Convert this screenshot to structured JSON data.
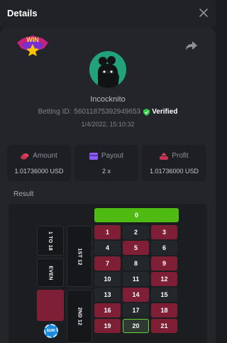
{
  "header": {
    "title": "Details",
    "close_icon": "close-icon"
  },
  "win_badge": {
    "text": "WIN"
  },
  "player": {
    "username": "Incocknito",
    "betting_id_label": "Betting ID:",
    "betting_id": "560118753929496​53",
    "verified_label": "Verified",
    "datetime": "1/4/2022, 15:10:32"
  },
  "stats": [
    {
      "label": "Amount",
      "value": "1.01736000 USD",
      "icon": "coins-icon",
      "color": "#e0415d"
    },
    {
      "label": "Payout",
      "value": "2 x",
      "icon": "payout-icon",
      "color": "#8b5cf6"
    },
    {
      "label": "Profit",
      "value": "1.01736000 USD",
      "icon": "profit-icon",
      "color": "#e0415d"
    }
  ],
  "result_label": "Result",
  "board": {
    "zero": "0",
    "numbers": [
      "1",
      "2",
      "3",
      "4",
      "5",
      "6",
      "7",
      "8",
      "9",
      "10",
      "11",
      "12",
      "13",
      "14",
      "15",
      "16",
      "17",
      "18",
      "19",
      "20",
      "21"
    ],
    "red_numbers": [
      "1",
      "3",
      "5",
      "7",
      "9",
      "12",
      "14",
      "16",
      "18",
      "19",
      "21"
    ],
    "winning_number": "20",
    "side_labels": {
      "range": "1 TO 18",
      "even": "EVEN",
      "dozen1": "1ST 12",
      "dozen2": "2ND 12"
    },
    "chip_label": "$10K"
  },
  "colors": {
    "green": "#4fba11",
    "red": "#7e1f35",
    "verified": "#2ecc40"
  }
}
